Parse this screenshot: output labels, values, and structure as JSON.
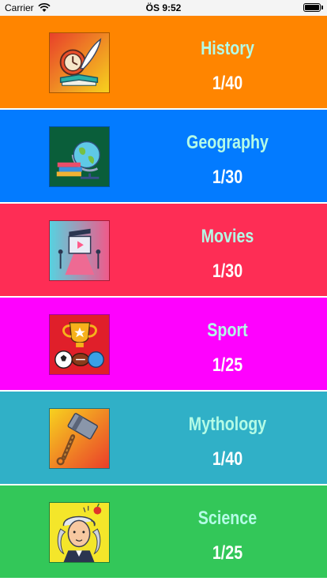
{
  "status_bar": {
    "carrier": "Carrier",
    "time": "ÖS 9:52"
  },
  "categories": [
    {
      "title": "History",
      "progress": "1/40",
      "color": "#ff8500",
      "icon": "history-icon"
    },
    {
      "title": "Geography",
      "progress": "1/30",
      "color": "#037bff",
      "icon": "globe-icon"
    },
    {
      "title": "Movies",
      "progress": "1/30",
      "color": "#fe2d55",
      "icon": "cinema-icon"
    },
    {
      "title": "Sport",
      "progress": "1/25",
      "color": "#fe02fe",
      "icon": "trophy-icon"
    },
    {
      "title": "Mythology",
      "progress": "1/40",
      "color": "#30b0c7",
      "icon": "hammer-icon"
    },
    {
      "title": "Science",
      "progress": "1/25",
      "color": "#33c759",
      "icon": "scientist-icon"
    }
  ]
}
